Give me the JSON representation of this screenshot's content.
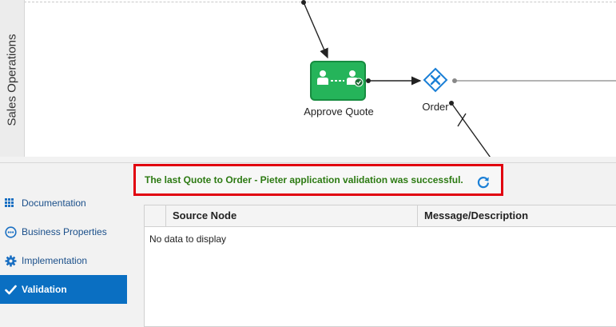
{
  "lane": {
    "title": "Sales Operations"
  },
  "diagram": {
    "task": {
      "label": "Approve Quote"
    },
    "gateway": {
      "label": "Order"
    }
  },
  "nav": {
    "items": [
      {
        "label": "Documentation",
        "icon": "documentation-icon"
      },
      {
        "label": "Business Properties",
        "icon": "business-properties-icon"
      },
      {
        "label": "Implementation",
        "icon": "gear-icon"
      },
      {
        "label": "Validation",
        "icon": "check-icon",
        "active": true
      }
    ]
  },
  "validation": {
    "message": "The last Quote to Order - Pieter application validation was successful.",
    "refresh_icon": "refresh-icon"
  },
  "table": {
    "columns": [
      "",
      "Source Node",
      "Message/Description"
    ],
    "empty_text": "No data to display"
  },
  "colors": {
    "task_fill": "#25b45a",
    "gateway_stroke": "#1a7fd6",
    "active_nav": "#0a6fc2",
    "success_text": "#2c7a12",
    "highlight_border": "#e1000f"
  }
}
